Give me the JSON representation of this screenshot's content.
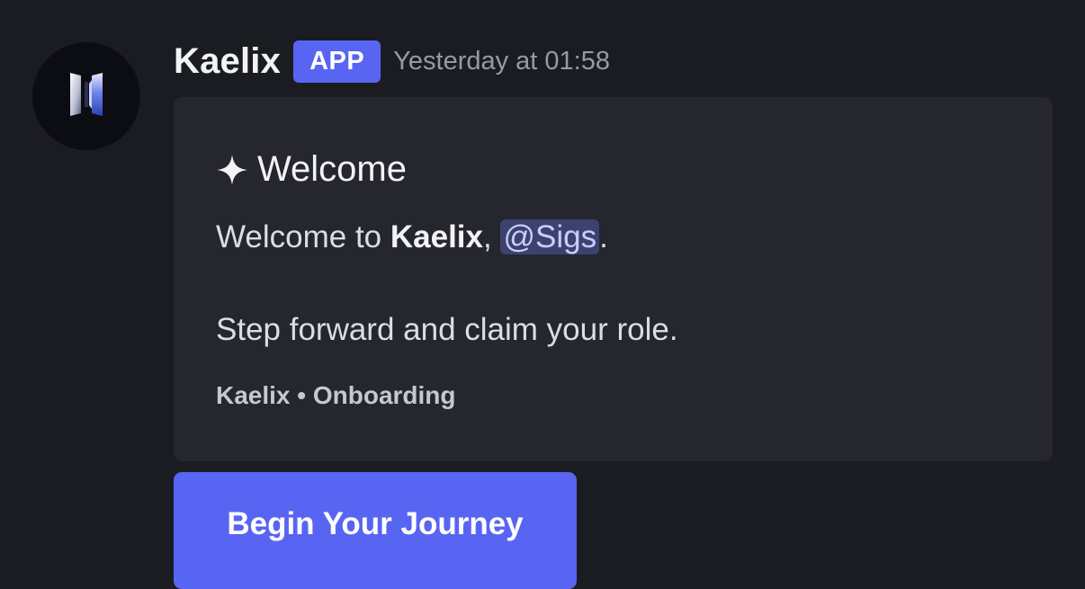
{
  "message": {
    "author": "Kaelix",
    "badge": "APP",
    "timestamp": "Yesterday at 01:58",
    "avatar_icon": "kaelix-logo-icon"
  },
  "embed": {
    "title_icon": "sparkle-icon",
    "title": "Welcome",
    "line1": {
      "prefix": "Welcome to ",
      "bold": "Kaelix",
      "separator": ", ",
      "mention": "@Sigs",
      "suffix": "."
    },
    "line2": "Step forward and claim your role.",
    "footer": "Kaelix • Onboarding"
  },
  "button": {
    "label": "Begin Your Journey"
  },
  "colors": {
    "background": "#1b1c22",
    "embed_background": "#26262f",
    "accent": "#5865f2",
    "mention_background": "#3c4270",
    "timestamp": "#949ba4"
  }
}
